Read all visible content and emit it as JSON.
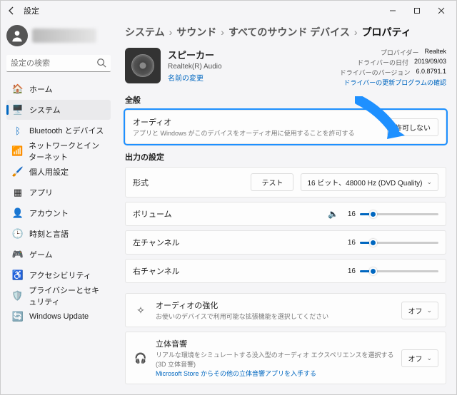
{
  "window": {
    "title": "設定"
  },
  "search": {
    "placeholder": "設定の検索"
  },
  "sidebar": {
    "items": [
      {
        "label": "ホーム"
      },
      {
        "label": "システム"
      },
      {
        "label": "Bluetooth とデバイス"
      },
      {
        "label": "ネットワークとインターネット"
      },
      {
        "label": "個人用設定"
      },
      {
        "label": "アプリ"
      },
      {
        "label": "アカウント"
      },
      {
        "label": "時刻と言語"
      },
      {
        "label": "ゲーム"
      },
      {
        "label": "アクセシビリティ"
      },
      {
        "label": "プライバシーとセキュリティ"
      },
      {
        "label": "Windows Update"
      }
    ]
  },
  "breadcrumb": {
    "b0": "システム",
    "b1": "サウンド",
    "b2": "すべてのサウンド デバイス",
    "b3": "プロパティ"
  },
  "device": {
    "name": "スピーカー",
    "sub": "Realtek(R) Audio",
    "rename": "名前の変更"
  },
  "meta": {
    "providerLbl": "プロバイダー",
    "providerVal": "Realtek",
    "dateLbl": "ドライバーの日付",
    "dateVal": "2019/09/03",
    "verLbl": "ドライバーのバージョン",
    "verVal": "6.0.8791.1",
    "update": "ドライバーの更新プログラムの確認"
  },
  "sections": {
    "general": "全般",
    "output": "出力の設定"
  },
  "audio": {
    "title": "オーディオ",
    "sub": "アプリと Windows がこのデバイスをオーディオ用に使用することを許可する",
    "btn": "許可しない"
  },
  "format": {
    "title": "形式",
    "test": "テスト",
    "value": "16 ビット、48000 Hz (DVD Quality)"
  },
  "volume": {
    "title": "ボリューム",
    "value": "16",
    "pct": 16
  },
  "left": {
    "title": "左チャンネル",
    "value": "16",
    "pct": 16
  },
  "right": {
    "title": "右チャンネル",
    "value": "16",
    "pct": 16
  },
  "enh": {
    "title": "オーディオの強化",
    "sub": "お使いのデバイスで利用可能な拡張機能を選択してください",
    "value": "オフ"
  },
  "spatial": {
    "title": "立体音響",
    "sub": "リアルな環境をシミュレートする没入型のオーディオ エクスペリエンスを選択する (3D 立体音響)",
    "link": "Microsoft Store からその他の立体音響アプリを入手する",
    "value": "オフ"
  }
}
